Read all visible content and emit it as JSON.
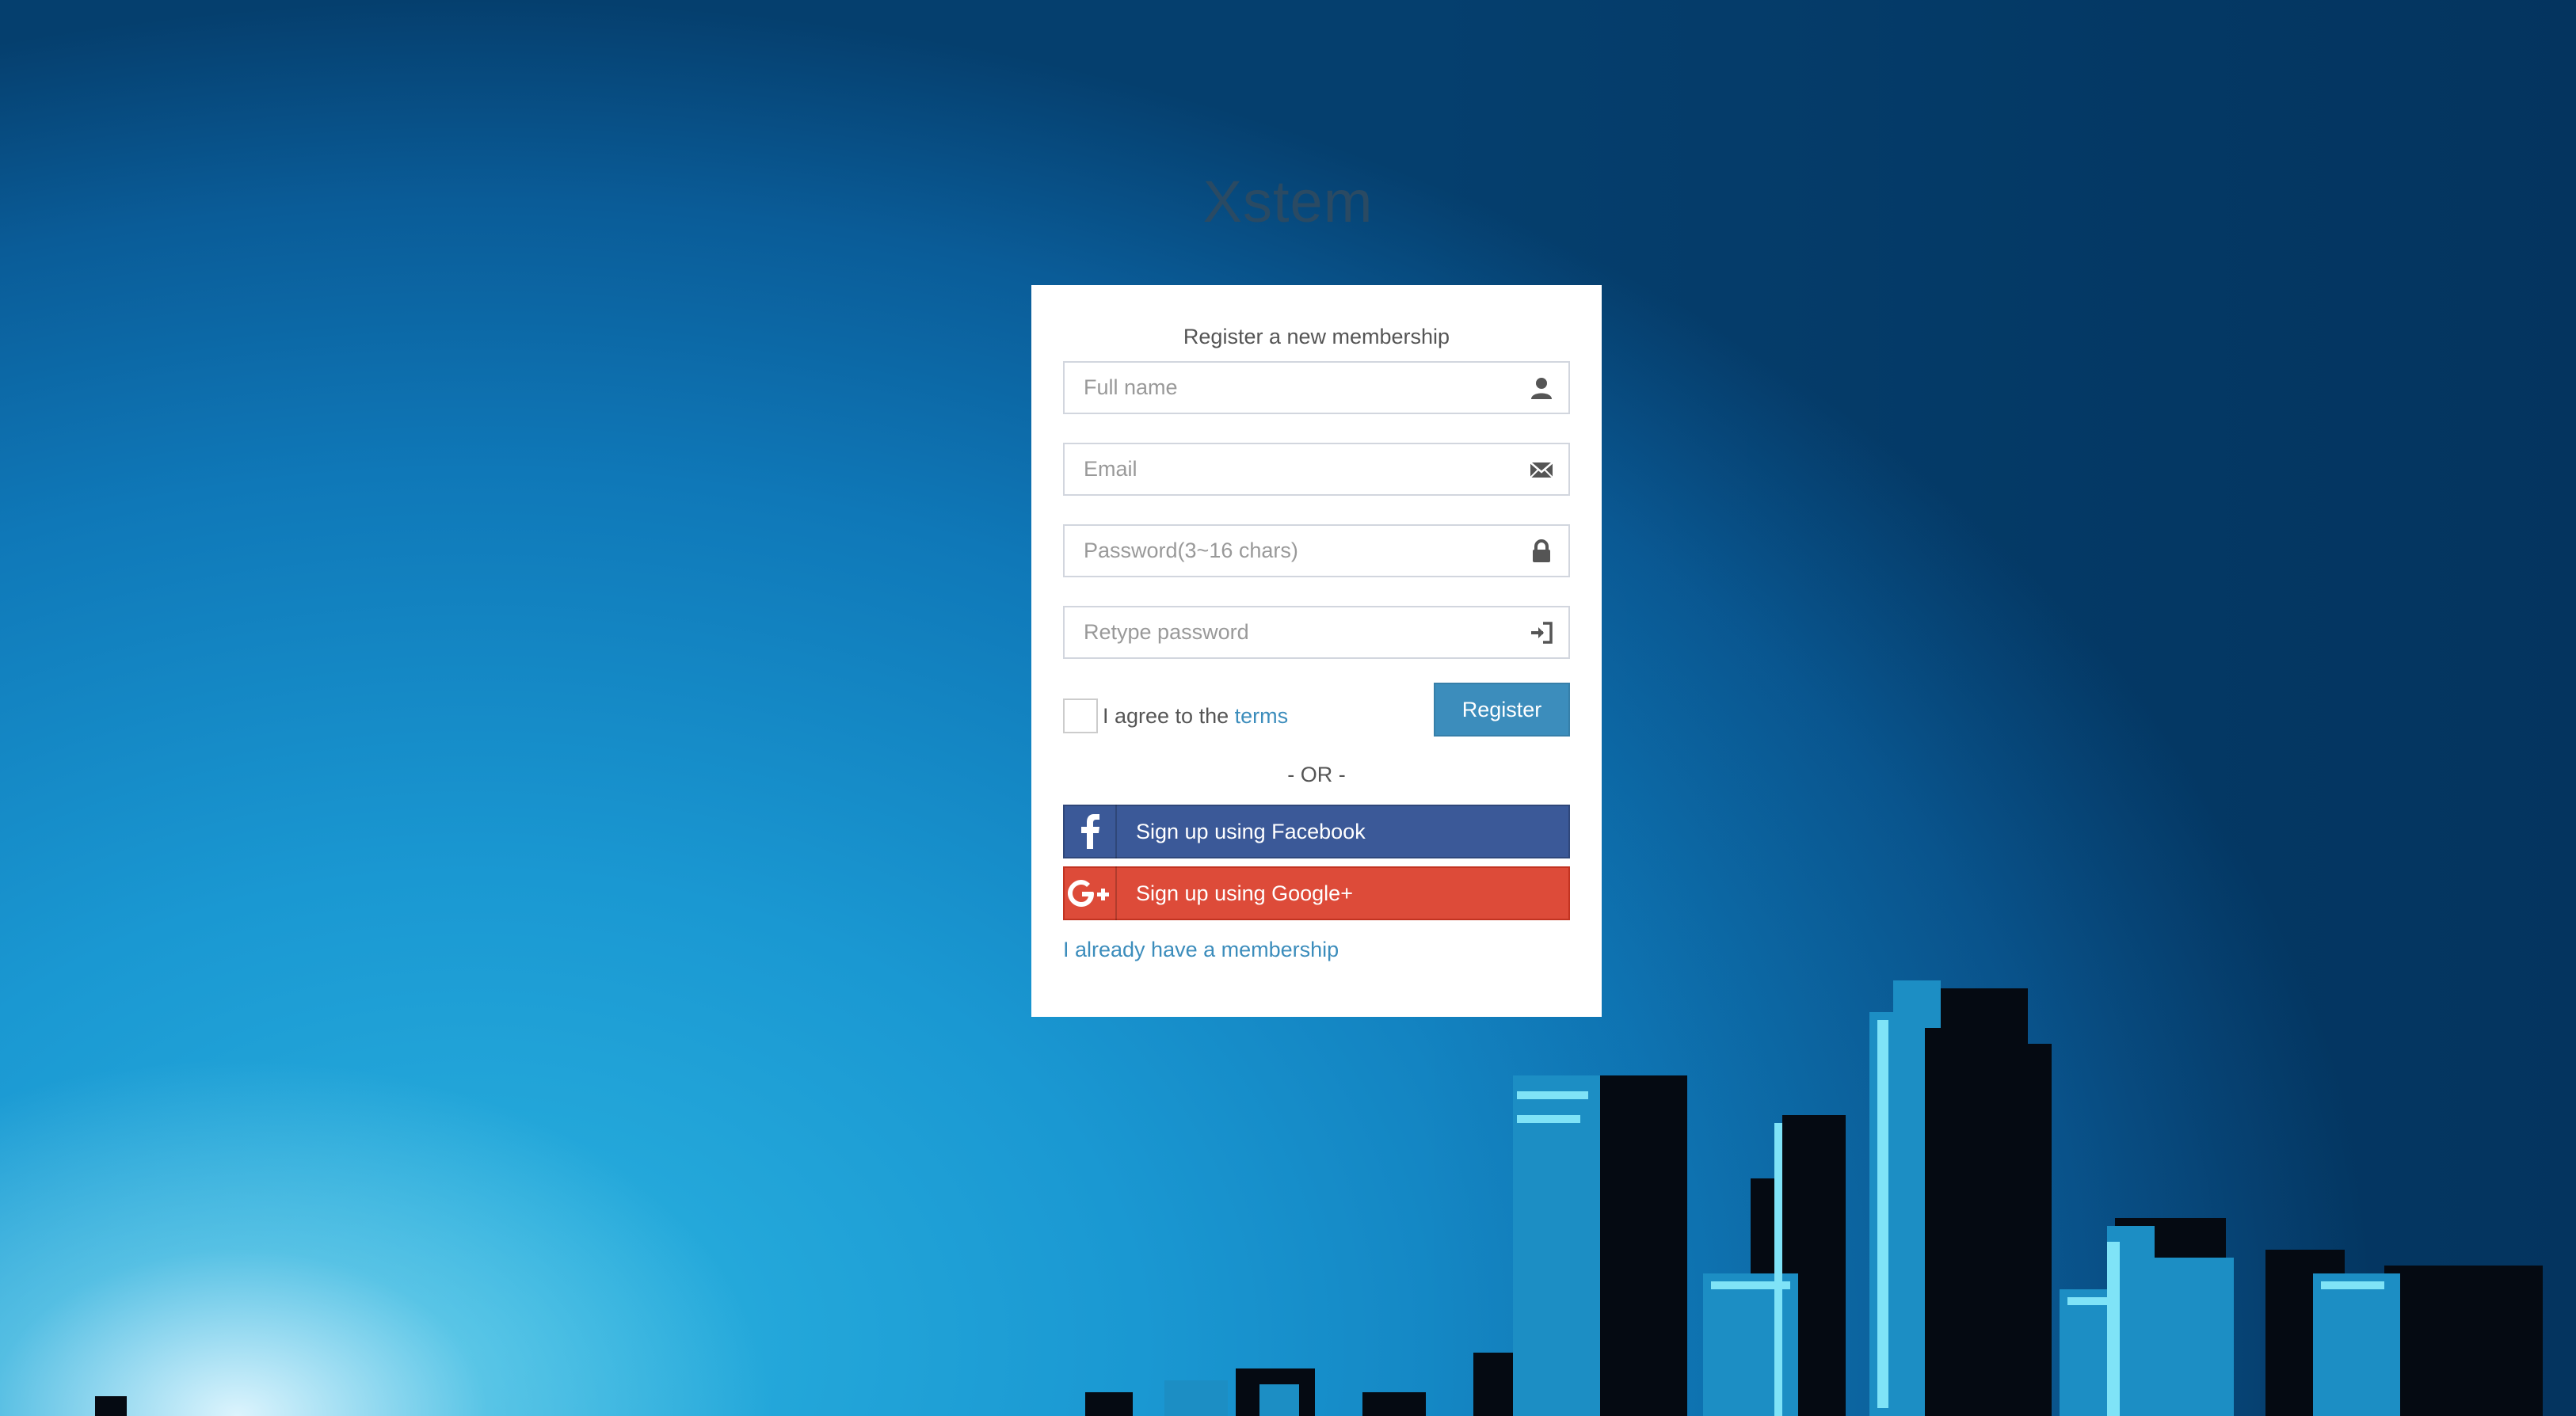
{
  "logo": {
    "text": "Xstem"
  },
  "box": {
    "message": "Register a new membership"
  },
  "fields": {
    "fullname": {
      "placeholder": "Full name",
      "icon": "user-icon"
    },
    "email": {
      "placeholder": "Email",
      "icon": "envelope-icon"
    },
    "password": {
      "placeholder": "Password(3~16 chars)",
      "icon": "lock-icon"
    },
    "retype": {
      "placeholder": "Retype password",
      "icon": "log-in-icon"
    }
  },
  "agree": {
    "prefix": "I agree to the",
    "link": "terms"
  },
  "register_label": "Register",
  "or_label": "- OR -",
  "social": {
    "facebook": {
      "label": "Sign up using Facebook",
      "icon": "facebook-icon",
      "color": "#3b5998"
    },
    "google": {
      "label": "Sign up using Google+",
      "icon": "google-plus-icon",
      "color": "#dd4b39"
    }
  },
  "membership_link": "I already have a membership",
  "colors": {
    "accent": "#3c8dbc"
  }
}
